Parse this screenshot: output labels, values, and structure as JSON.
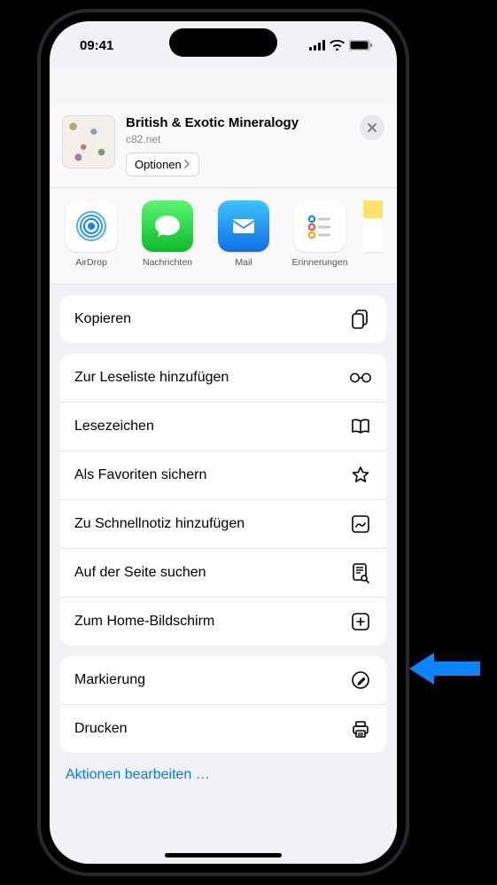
{
  "status": {
    "time": "09:41"
  },
  "header": {
    "title": "British & Exotic Mineralogy",
    "subtitle": "c82.net",
    "options_label": "Optionen"
  },
  "apps": {
    "airdrop": {
      "label": "AirDrop",
      "icon": "airdrop-icon"
    },
    "messages": {
      "label": "Nachrichten",
      "icon": "messages-icon"
    },
    "mail": {
      "label": "Mail",
      "icon": "mail-icon"
    },
    "reminders": {
      "label": "Erinnerungen",
      "icon": "reminders-icon"
    },
    "notes": {
      "label": "",
      "icon": "notes-icon"
    }
  },
  "actions": {
    "copy": "Kopieren",
    "reading_list": "Zur Leseliste hinzufügen",
    "bookmark": "Lesezeichen",
    "favorite": "Als Favoriten sichern",
    "quick_note": "Zu Schnellnotiz hinzufügen",
    "find_on_page": "Auf der Seite suchen",
    "add_to_home": "Zum Home-Bildschirm",
    "markup": "Markierung",
    "print": "Drucken"
  },
  "edit_actions": "Aktionen bearbeiten …"
}
